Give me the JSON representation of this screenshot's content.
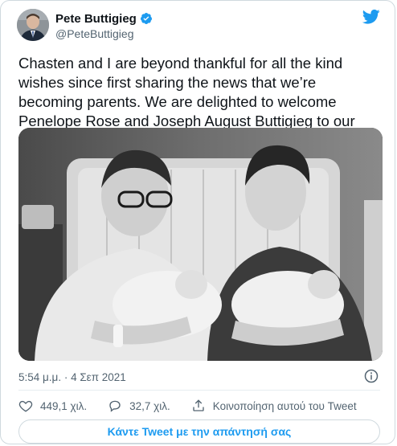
{
  "author": {
    "name": "Pete Buttigieg",
    "handle": "@PeteButtigieg"
  },
  "tweet": {
    "text": "Chasten and I are beyond thankful for all the kind wishes since first sharing the news that we’re becoming parents. We are delighted to welcome Penelope Rose and Joseph August Buttigieg to our family.",
    "timestamp": "5:54 μ.μ. · 4 Σεπ 2021"
  },
  "actions": {
    "likes": "449,1 χιλ.",
    "replies": "32,7 χιλ.",
    "share_label": "Κοινοποίηση αυτού του Tweet"
  },
  "reply_button_label": "Κάντε Tweet με την απάντησή σας",
  "colors": {
    "accent": "#1d9bf0",
    "text_primary": "#0f1419",
    "text_secondary": "#536471",
    "border": "#cfd9de"
  },
  "icons": {
    "verified": "verified-badge-icon",
    "brand": "twitter-bird-icon",
    "info": "info-icon",
    "like": "heart-icon",
    "reply": "speech-bubble-icon",
    "share": "share-upload-icon"
  }
}
